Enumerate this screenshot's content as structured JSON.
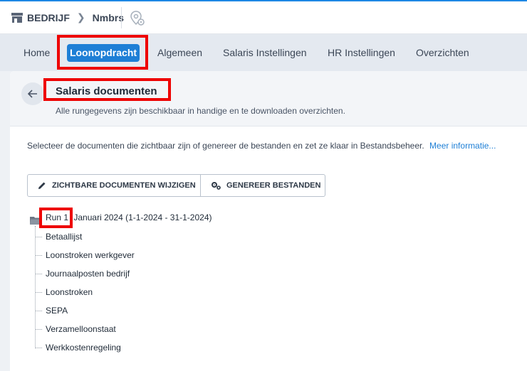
{
  "breadcrumb": {
    "company": "BEDRIJF",
    "employer": "Nmbrs"
  },
  "nav": {
    "home": "Home",
    "active": "Loonopdracht",
    "general": "Algemeen",
    "salary_settings": "Salaris Instellingen",
    "hr_settings": "HR Instellingen",
    "overviews": "Overzichten"
  },
  "page": {
    "title": "Salaris documenten",
    "subtitle": "Alle rungegevens zijn beschikbaar in handige en te downloaden overzichten."
  },
  "info": {
    "text": "Selecteer de documenten die zichtbaar zijn of genereer de bestanden en zet ze klaar in Bestandsbeheer.",
    "link": "Meer informatie..."
  },
  "buttons": {
    "edit_visible": "ZICHTBARE DOCUMENTEN WIJZIGEN",
    "generate": "GENEREER BESTANDEN"
  },
  "tree": {
    "run_label": "Run 1",
    "run_period": "Januari 2024 (1-1-2024 - 31-1-2024)",
    "items": [
      "Betaallijst",
      "Loonstroken werkgever",
      "Journaalposten bedrijf",
      "Loonstroken",
      "SEPA",
      "Verzamelloonstaat",
      "Werkkostenregeling"
    ]
  },
  "colors": {
    "accent": "#1e7fd6",
    "highlight": "#ee0000"
  }
}
